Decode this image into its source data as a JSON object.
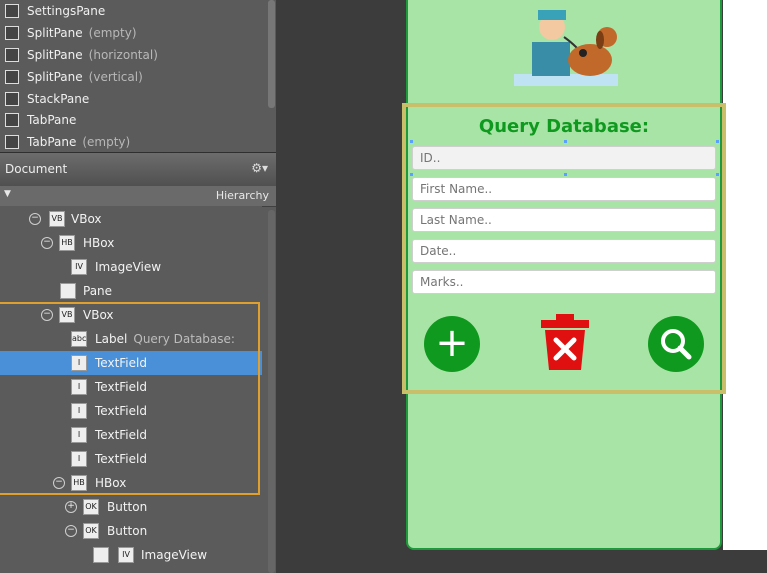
{
  "library": {
    "items": [
      {
        "label": "SettingsPane",
        "note": ""
      },
      {
        "label": "SplitPane",
        "note": "(empty)"
      },
      {
        "label": "SplitPane",
        "note": "(horizontal)"
      },
      {
        "label": "SplitPane",
        "note": "(vertical)"
      },
      {
        "label": "StackPane",
        "note": ""
      },
      {
        "label": "TabPane",
        "note": ""
      },
      {
        "label": "TabPane",
        "note": "(empty)"
      }
    ]
  },
  "document": {
    "title": "Document",
    "gear": "⚙▾"
  },
  "hierarchy": {
    "title": "Hierarchy"
  },
  "tree": [
    {
      "label": "VBox",
      "note": "",
      "icon": "VB"
    },
    {
      "label": "HBox",
      "note": "",
      "icon": "HB"
    },
    {
      "label": "ImageView",
      "note": "",
      "icon": "IV"
    },
    {
      "label": "Pane",
      "note": "",
      "icon": ""
    },
    {
      "label": "VBox",
      "note": "",
      "icon": "VB"
    },
    {
      "label": "Label",
      "note": "Query Database:",
      "icon": "abc"
    },
    {
      "label": "TextField",
      "note": "",
      "icon": "I"
    },
    {
      "label": "TextField",
      "note": "",
      "icon": "I"
    },
    {
      "label": "TextField",
      "note": "",
      "icon": "I"
    },
    {
      "label": "TextField",
      "note": "",
      "icon": "I"
    },
    {
      "label": "TextField",
      "note": "",
      "icon": "I"
    },
    {
      "label": "HBox",
      "note": "",
      "icon": "HB"
    },
    {
      "label": "Button",
      "note": "",
      "icon": "OK"
    },
    {
      "label": "Button",
      "note": "",
      "icon": "OK"
    },
    {
      "label": "ImageView",
      "note": "",
      "icon": "IV"
    }
  ],
  "form": {
    "title": "Query Database:",
    "fields": [
      {
        "placeholder": "ID.."
      },
      {
        "placeholder": "First Name.."
      },
      {
        "placeholder": "Last Name.."
      },
      {
        "placeholder": "Date.."
      },
      {
        "placeholder": "Marks.."
      }
    ],
    "buttons": {
      "add": "+",
      "delete": "✕",
      "search": "⌕"
    }
  },
  "colors": {
    "accent_green": "#0f9a1f",
    "background_green": "#a9e4a7",
    "delete_red": "#e01010",
    "selection_blue": "#4a90d9"
  }
}
